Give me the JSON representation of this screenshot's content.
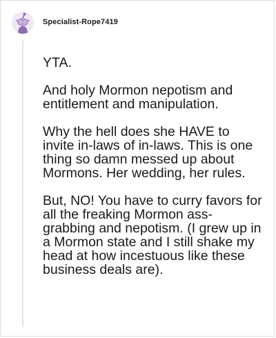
{
  "comment": {
    "author": "Specialist-Rope7419",
    "avatar_icon": "snoo-avatar-icon",
    "accent_color": "#8e6cb0",
    "paragraphs": [
      "YTA.",
      "And holy Mormon nepotism and entitlement and manipulation.",
      "Why the hell does she HAVE to invite in-laws of in-laws. This is one thing so damn messed up about Mormons. Her wedding, her rules.",
      "But, NO! You have to curry favors for all the freaking Mormon ass-grabbing and nepotism. (I grew up in a Mormon state and I still shake my head at how incestuous like these business deals are)."
    ]
  }
}
